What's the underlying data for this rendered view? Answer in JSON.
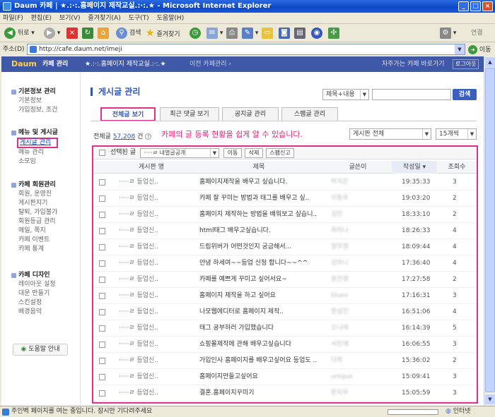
{
  "window": {
    "title": "Daum 카페 | ★.:·:.홈페이지 제작교실.:·:.★ - Microsoft Internet Explorer",
    "min": "_",
    "max": "□",
    "close": "×"
  },
  "menu": [
    "파일(F)",
    "편집(E)",
    "보기(V)",
    "즐겨찾기(A)",
    "도구(T)",
    "도움말(H)"
  ],
  "toolbar": {
    "back": "뒤로",
    "search": "검색",
    "favorites": "즐겨찾기",
    "links": "연결"
  },
  "address": {
    "label": "주소(D)",
    "url": "http://cafe.daum.net/imeji",
    "go": "이동"
  },
  "cafe_header": {
    "logo": "Daum",
    "admin": "카페 관리",
    "cafe_name": "★.:·:.홈페이지 제작교실.:·:.★",
    "prev": "이전 카페관리 ›",
    "shortcut": "자주가는 카페 바로가기",
    "logout": "로그아웃"
  },
  "sidebar": {
    "sections": [
      {
        "title": "기본정보 관리",
        "items": [
          "기본정보",
          "가입정보, 조건"
        ]
      },
      {
        "title": "메뉴 및 게시글",
        "items": [
          "게시글 관리",
          "메뉴 관리",
          "소모임"
        ]
      },
      {
        "title": "카페 회원관리",
        "items": [
          "회원, 운영진",
          "게시판지기",
          "탈퇴, 가입불가",
          "회원등급 관리",
          "메일, 쪽지",
          "카페 이벤트",
          "카페 통계"
        ]
      },
      {
        "title": "카페 디자인",
        "items": [
          "레이아웃 설정",
          "대문 만들기",
          "스킨설정",
          "배경음악"
        ]
      }
    ],
    "help": "도움말 안내"
  },
  "main": {
    "title": "게시글 관리",
    "search_select": "제목+내용",
    "search_button": "검색",
    "tabs": [
      "전체글 보기",
      "최근 댓글 보기",
      "공지글 관리",
      "스팸글 관리"
    ],
    "count_prefix": "전체글",
    "count_value": "57,208",
    "count_suffix": "건",
    "annotation": "카페의 글 등록 현황을 쉽게 알 수 있습니다.",
    "board_select": "게시판 전체",
    "per_page": "15개씩",
    "actions": {
      "select_label": "선택된 글",
      "move_select": "·····ㄹ 내열글공개",
      "move": "이동",
      "delete": "삭제",
      "spam": "스팸신고"
    },
    "columns": [
      "게시판 명",
      "제목",
      "글쓴이",
      "작성일 ▾",
      "조회수"
    ],
    "rows": [
      {
        "board": "·····ㄹ 등업신..",
        "subject": "홈페이지제작을 배우고 싶습니다.",
        "author": "박지은",
        "date": "19:35:33",
        "views": "3"
      },
      {
        "board": "·····ㄹ 등업신..",
        "subject": "카페 잘 꾸미는 방법과 태그를 배우고 싶..",
        "author": "이동우",
        "date": "19:03:20",
        "views": "2"
      },
      {
        "board": "·····ㄹ 등업신..",
        "subject": "홈페이지 제작하는 방법을 배워보고 싶습니..",
        "author": "김민",
        "date": "18:33:10",
        "views": "2"
      },
      {
        "board": "·····ㄹ 등업신..",
        "subject": "html태그 배우고싶습니다.",
        "author": "최하나",
        "date": "18:26:33",
        "views": "4"
      },
      {
        "board": "·····ㄹ 등업신..",
        "subject": "드림위버가 어떤것인지 궁금해서...",
        "author": "정우영",
        "date": "18:09:44",
        "views": "4"
      },
      {
        "board": "·····ㄹ 등업신..",
        "subject": "안녕 하세여~~등업 신청 합니다~~^^",
        "author": "강하니",
        "date": "17:36:40",
        "views": "4"
      },
      {
        "board": "·····ㄹ 등업신..",
        "subject": "카페를 예쁘게 꾸미고 싶어서요~",
        "author": "윤진경",
        "date": "17:27:58",
        "views": "2"
      },
      {
        "board": "·····ㄹ 등업신..",
        "subject": "홈페이지 제작을 하고 싶어요",
        "author": "bluex",
        "date": "17:16:31",
        "views": "3"
      },
      {
        "board": "·····ㄹ 등업신..",
        "subject": "나모웹에디터로 홈페이지 제작..",
        "author": "한성진",
        "date": "16:51:06",
        "views": "4"
      },
      {
        "board": "·····ㄹ 등업신..",
        "subject": "태그 공부하러 가입했습니다",
        "author": "오나래",
        "date": "16:14:39",
        "views": "5"
      },
      {
        "board": "·····ㄹ 등업신..",
        "subject": "쇼핑몰제작에 관해 배우고싶습니다",
        "author": "서민재",
        "date": "16:06:55",
        "views": "3"
      },
      {
        "board": "·····ㄹ 등업신..",
        "subject": "가입인사 홈페이지를 배우고싶어요 등업도 ..",
        "author": "다희",
        "date": "15:36:02",
        "views": "2"
      },
      {
        "board": "·····ㄹ 등업신..",
        "subject": "홈페이지만들고싶어요",
        "author": "unique",
        "date": "15:09:41",
        "views": "3"
      },
      {
        "board": "·····ㄹ 등업신..",
        "subject": "결혼.홈페이지꾸미기",
        "author": "문지우",
        "date": "15:05:59",
        "views": "3"
      },
      {
        "board": "·····ㄹ 등업신..",
        "subject": "홈페이지 호스팅에서 운영까지 배우고 싶어..",
        "author": "하나바다",
        "date": "15:03:07",
        "views": "2"
      }
    ]
  },
  "status": {
    "text": "주인벽 페이지를 여는 중입니다. 잠시만 기다려주세요",
    "zone": "인터넷"
  }
}
